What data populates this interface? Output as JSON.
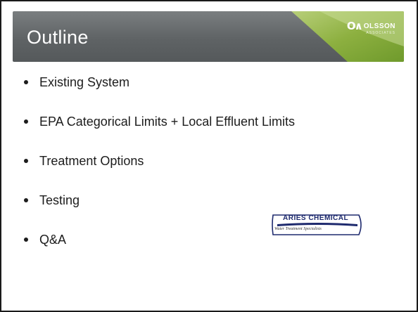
{
  "slide": {
    "title": "Outline",
    "logo": {
      "brand": "OLSSON",
      "subtitle": "ASSOCIATES"
    },
    "bullets": [
      "Existing System",
      "EPA Categorical Limits + Local Effluent Limits",
      "Treatment Options",
      "Testing",
      "Q&A"
    ],
    "partner_logo": {
      "name": "ARIES CHEMICAL",
      "tagline": "Water Treatment Specialists"
    }
  },
  "colors": {
    "header_gray": "#5f6365",
    "accent_green": "#8db040",
    "aries_blue": "#1e2a6e"
  }
}
